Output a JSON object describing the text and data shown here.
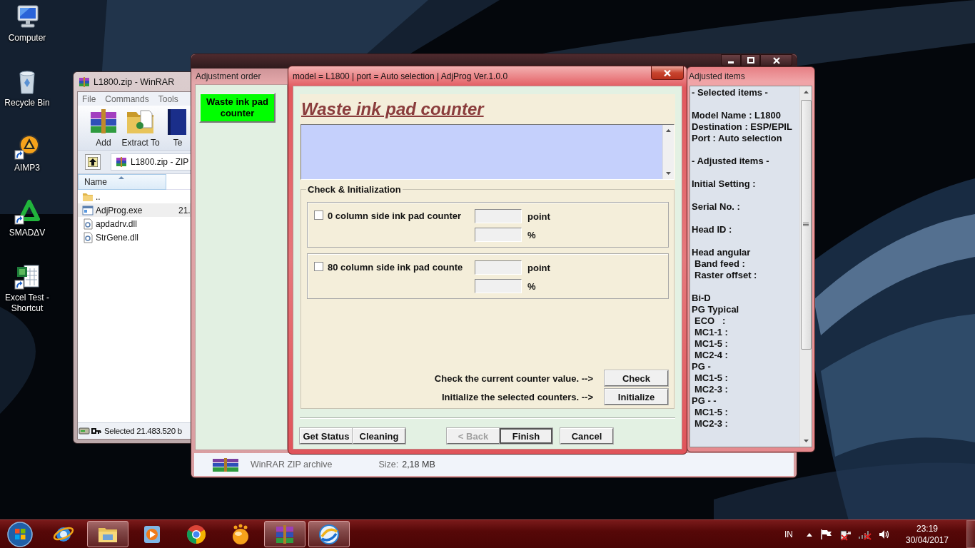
{
  "desktop": {
    "icons": [
      {
        "label": "Computer",
        "kind": "computer"
      },
      {
        "label": "Recycle Bin",
        "kind": "bin"
      },
      {
        "label": "AIMP3",
        "kind": "player"
      },
      {
        "label": "SMADΔV",
        "kind": "shield"
      },
      {
        "label": "Excel Test - Shortcut",
        "kind": "sheet"
      }
    ]
  },
  "winrar": {
    "title": "L1800.zip - WinRAR",
    "menu": [
      "File",
      "Commands",
      "Tools"
    ],
    "toolbar": [
      {
        "label": "Add",
        "kind": "books"
      },
      {
        "label": "Extract To",
        "kind": "folder"
      },
      {
        "label": "Te",
        "kind": "book"
      }
    ],
    "path": "L1800.zip - ZIP",
    "columns": [
      "Name"
    ],
    "files": [
      {
        "name": "..",
        "kind": "folder",
        "selected": false
      },
      {
        "name": "AdjProg.exe",
        "kind": "exe",
        "column_2": "21.",
        "selected": true
      },
      {
        "name": "apdadrv.dll",
        "kind": "dll",
        "selected": false
      },
      {
        "name": "StrGene.dll",
        "kind": "dll",
        "selected": false
      }
    ],
    "status": "Selected 21.483.520 b"
  },
  "adjprog": {
    "order_title": "Adjustment order",
    "order_items": [
      {
        "label": "Waste ink pad counter",
        "selected": true
      }
    ],
    "details": {
      "type": "WinRAR ZIP archive",
      "size_label": "Size:",
      "size": "2,18 MB"
    }
  },
  "dialog": {
    "title": "model = L1800 | port = Auto selection | AdjProg Ver.1.0.0",
    "heading": "Waste ink pad counter",
    "group": "Check & Initialization",
    "counters": [
      {
        "label": "0 column side ink pad counter",
        "checked": false,
        "units": [
          "point",
          "%"
        ]
      },
      {
        "label": "80 column side ink pad counte",
        "checked": false,
        "units": [
          "point",
          "%"
        ]
      }
    ],
    "actions": [
      {
        "text": "Check the current counter value. -->",
        "button": "Check"
      },
      {
        "text": "Initialize the selected counters. -->",
        "button": "Initialize"
      }
    ],
    "buttons": [
      {
        "label": "Get Status",
        "disabled": false,
        "default": false
      },
      {
        "label": "Cleaning",
        "disabled": false,
        "default": false
      },
      {
        "label": "< Back",
        "disabled": true,
        "default": false
      },
      {
        "label": "Finish",
        "disabled": false,
        "default": true
      },
      {
        "label": "Cancel",
        "disabled": false,
        "default": false
      }
    ]
  },
  "adjusted": {
    "title": "Adjusted items",
    "sections": [
      {
        "lines": [
          {
            "text": "- Selected items -"
          }
        ]
      },
      {
        "lines": [
          {
            "text": "Model Name : L1800"
          },
          {
            "text": "Destination : ESP/EPIL"
          },
          {
            "text": "Port : Auto selection"
          }
        ]
      },
      {
        "lines": [
          {
            "text": "- Adjusted items -"
          }
        ]
      },
      {
        "lines": [
          {
            "text": "Initial Setting :"
          }
        ]
      },
      {
        "lines": [
          {
            "text": "Serial No. :"
          }
        ]
      },
      {
        "lines": [
          {
            "text": "Head ID :"
          }
        ]
      },
      {
        "lines": [
          {
            "text": "Head angular",
            "children": [
              {
                "text": "Band feed :"
              },
              {
                "text": "Raster offset :"
              }
            ]
          }
        ]
      },
      {
        "lines": [
          {
            "text": "Bi-D"
          },
          {
            "text": "PG Typical",
            "children": [
              {
                "text": "ECO   :"
              },
              {
                "text": "MC1-1 :"
              },
              {
                "text": "MC1-5 :"
              },
              {
                "text": "MC2-4 :"
              }
            ]
          },
          {
            "text": "PG -",
            "children": [
              {
                "text": "MC1-5 :"
              },
              {
                "text": "MC2-3 :"
              }
            ]
          },
          {
            "text": "PG - -",
            "children": [
              {
                "text": "MC1-5 :"
              },
              {
                "text": "MC2-3 :"
              }
            ]
          }
        ]
      }
    ]
  },
  "taskbar": {
    "apps": [
      {
        "kind": "globe",
        "active": false
      },
      {
        "kind": "folder",
        "active": true
      },
      {
        "kind": "media",
        "active": false
      },
      {
        "kind": "wheel",
        "active": false
      },
      {
        "kind": "bubbles",
        "active": false
      },
      {
        "kind": "books",
        "active": true
      },
      {
        "kind": "swirl",
        "active": true
      }
    ],
    "tray": {
      "language": "IN",
      "time": "23:19",
      "date": "30/04/2017"
    }
  }
}
